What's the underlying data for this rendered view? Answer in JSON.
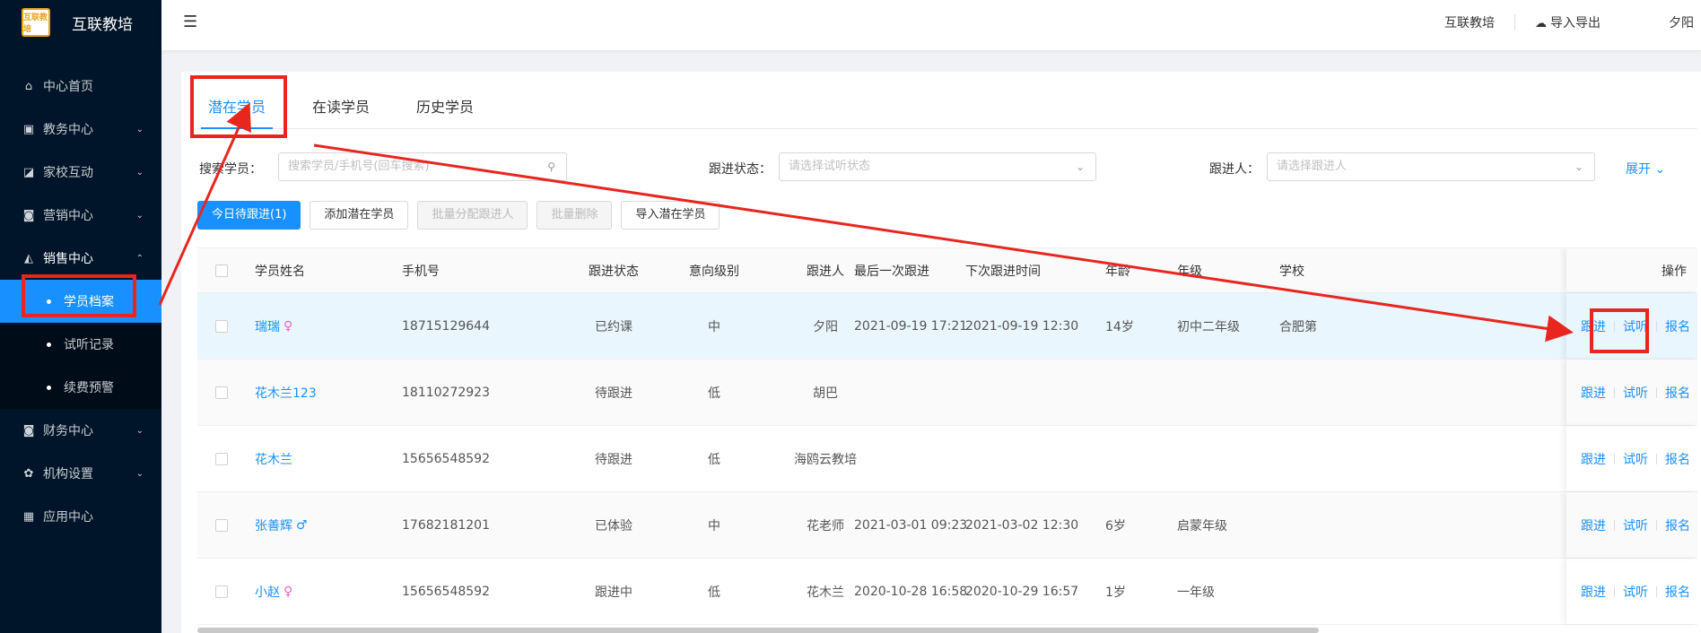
{
  "app": {
    "title": "互联教培",
    "logo_text": "互联教培"
  },
  "sidebar": {
    "items": [
      {
        "label": "中心首页",
        "icon": "home-icon",
        "glyph": "⌂",
        "chevron": ""
      },
      {
        "label": "教务中心",
        "icon": "book-icon",
        "glyph": "▣",
        "chevron": "⌄"
      },
      {
        "label": "家校互动",
        "icon": "chat-icon",
        "glyph": "◪",
        "chevron": "⌄"
      },
      {
        "label": "营销中心",
        "icon": "bag-icon",
        "glyph": "◙",
        "chevron": "⌄"
      },
      {
        "label": "销售中心",
        "icon": "chart-icon",
        "glyph": "◭",
        "chevron": "⌃"
      }
    ],
    "sub_items": [
      {
        "label": "学员档案"
      },
      {
        "label": "试听记录"
      },
      {
        "label": "续费预警"
      }
    ],
    "items_after": [
      {
        "label": "财务中心",
        "icon": "wallet-icon",
        "glyph": "◙",
        "chevron": "⌄"
      },
      {
        "label": "机构设置",
        "icon": "gear-icon",
        "glyph": "✿",
        "chevron": "⌄"
      },
      {
        "label": "应用中心",
        "icon": "grid-icon",
        "glyph": "▦",
        "chevron": ""
      }
    ]
  },
  "topbar": {
    "org": "互联教培",
    "import_export": "导入导出",
    "user": "夕阳"
  },
  "tabs": [
    "潜在学员",
    "在读学员",
    "历史学员"
  ],
  "filters": {
    "search_label": "搜索学员：",
    "search_placeholder": "搜索学员/手机号(回车搜索)",
    "status_label": "跟进状态：",
    "status_placeholder": "请选择试听状态",
    "follower_label": "跟进人：",
    "follower_placeholder": "请选择跟进人",
    "expand": "展开"
  },
  "buttons": {
    "today": "今日待跟进(1)",
    "add": "添加潜在学员",
    "batch_assign": "批量分配跟进人",
    "batch_delete": "批量删除",
    "import": "导入潜在学员"
  },
  "table": {
    "headers": [
      "学员姓名",
      "手机号",
      "跟进状态",
      "意向级别",
      "跟进人",
      "最后一次跟进",
      "下次跟进时间",
      "年龄",
      "年级",
      "学校",
      "操作"
    ],
    "ops": [
      "跟进",
      "试听",
      "报名"
    ],
    "rows": [
      {
        "name": "瑞瑞",
        "gender": "♀",
        "phone": "18715129644",
        "status": "已约课",
        "level": "中",
        "follower": "夕阳",
        "last": "2021-09-19 17:21",
        "next": "2021-09-19 12:30",
        "age": "14岁",
        "grade": "初中二年级",
        "school": "合肥第"
      },
      {
        "name": "花木兰123",
        "gender": "",
        "phone": "18110272923",
        "status": "待跟进",
        "level": "低",
        "follower": "胡巴",
        "last": "",
        "next": "",
        "age": "",
        "grade": "",
        "school": ""
      },
      {
        "name": "花木兰",
        "gender": "",
        "phone": "15656548592",
        "status": "待跟进",
        "level": "低",
        "follower": "海鸥云教培",
        "last": "",
        "next": "",
        "age": "",
        "grade": "",
        "school": ""
      },
      {
        "name": "张善辉",
        "gender": "♂",
        "phone": "17682181201",
        "status": "已体验",
        "level": "中",
        "follower": "花老师",
        "last": "2021-03-01 09:23",
        "next": "2021-03-02 12:30",
        "age": "6岁",
        "grade": "启蒙年级",
        "school": ""
      },
      {
        "name": "小赵",
        "gender": "♀",
        "phone": "15656548592",
        "status": "跟进中",
        "level": "低",
        "follower": "花木兰",
        "last": "2020-10-28 16:58",
        "next": "2020-10-29 16:57",
        "age": "1岁",
        "grade": "一年级",
        "school": ""
      }
    ]
  },
  "colors": {
    "primary": "#1890ff",
    "sidebar": "#001529",
    "annotation": "#e8261f"
  }
}
